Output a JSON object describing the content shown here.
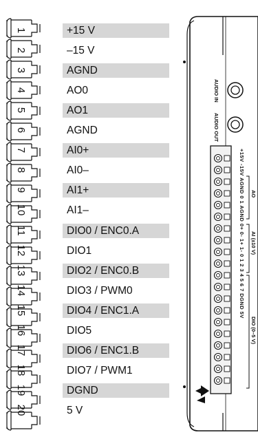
{
  "pins": [
    {
      "number": "1",
      "label": "+15 V",
      "shaded": true
    },
    {
      "number": "2",
      "label": "–15 V",
      "shaded": false
    },
    {
      "number": "3",
      "label": "AGND",
      "shaded": true
    },
    {
      "number": "4",
      "label": "AO0",
      "shaded": false
    },
    {
      "number": "5",
      "label": "AO1",
      "shaded": true
    },
    {
      "number": "6",
      "label": "AGND",
      "shaded": false
    },
    {
      "number": "7",
      "label": "AI0+",
      "shaded": true
    },
    {
      "number": "8",
      "label": "AI0–",
      "shaded": false
    },
    {
      "number": "9",
      "label": "AI1+",
      "shaded": true
    },
    {
      "number": "10",
      "label": "AI1–",
      "shaded": false
    },
    {
      "number": "11",
      "label": "DIO0 / ENC0.A",
      "shaded": true
    },
    {
      "number": "12",
      "label": "DIO1",
      "shaded": false
    },
    {
      "number": "13",
      "label": "DIO2 / ENC0.B",
      "shaded": true
    },
    {
      "number": "14",
      "label": "DIO3 / PWM0",
      "shaded": false
    },
    {
      "number": "15",
      "label": "DIO4 / ENC1.A",
      "shaded": true
    },
    {
      "number": "16",
      "label": "DIO5",
      "shaded": false
    },
    {
      "number": "17",
      "label": "DIO6 / ENC1.B",
      "shaded": true
    },
    {
      "number": "18",
      "label": "DIO7 / PWM1",
      "shaded": false
    },
    {
      "number": "19",
      "label": "DGND",
      "shaded": true
    },
    {
      "number": "20",
      "label": "5 V",
      "shaded": false
    }
  ],
  "device": {
    "audio_in_label": "AUDIO IN",
    "audio_out_label": "AUDIO OUT",
    "header_labels": "+15V -15V AGND 0 1 AGND 0+ 0- 1+ 1- 0 1 2 3 4 5 6 7 DGND 5V",
    "group_ao": "AO",
    "group_ai": "AI (±10 V)",
    "group_dio": "DIO (0–5 V)"
  },
  "colors": {
    "band": "#d6d6d6",
    "ink": "#111111",
    "connector_fill": "#f2f2f2"
  }
}
